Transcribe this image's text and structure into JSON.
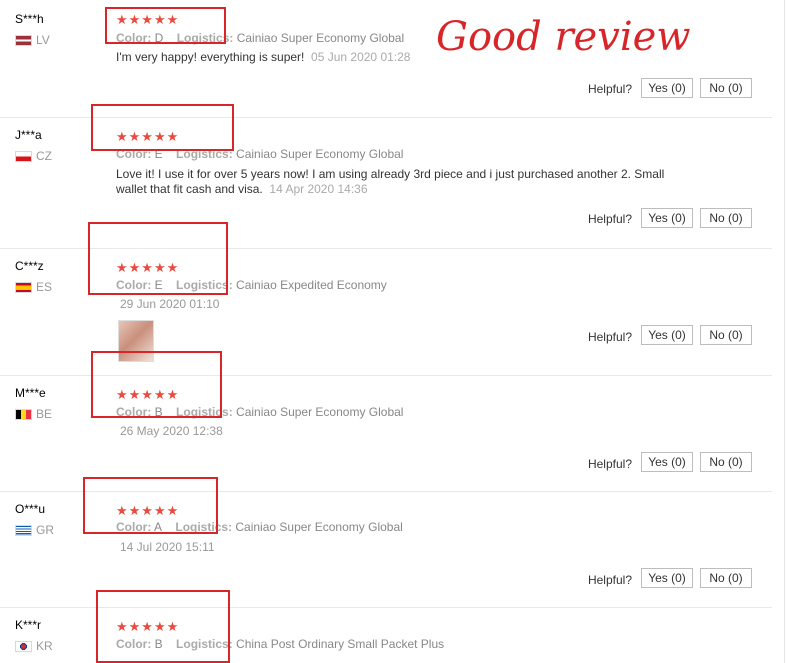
{
  "headline": "Good review",
  "colors": {
    "accent": "#e94b40",
    "annotation": "#d7252a"
  },
  "helpful_label": "Helpful?",
  "reviews": [
    {
      "name": "S***h",
      "country": "LV",
      "stars": "★★★★★",
      "color_label": "Color:",
      "color": "D",
      "logistics_label": "Logistics:",
      "logistics": "Cainiao Super Economy Global",
      "text": "I'm very happy! everything is super!",
      "date": "05 Jun 2020 01:28",
      "yes": "Yes (0)",
      "no": "No (0)"
    },
    {
      "name": "J***a",
      "country": "CZ",
      "stars": "★★★★★",
      "color_label": "Color:",
      "color": "E",
      "logistics_label": "Logistics:",
      "logistics": "Cainiao Super Economy Global",
      "text_line1": "Love it! I use it for over 5 years now! I am using already 3rd piece and i just purchased another 2. Small",
      "text_line2": "wallet that fit cash and visa.",
      "date": "14 Apr 2020 14:36",
      "yes": "Yes (0)",
      "no": "No (0)"
    },
    {
      "name": "C***z",
      "country": "ES",
      "stars": "★★★★★",
      "color_label": "Color:",
      "color": "E",
      "logistics_label": "Logistics:",
      "logistics": "Cainiao Expedited Economy",
      "date": "29 Jun 2020 01:10",
      "yes": "Yes (0)",
      "no": "No (0)"
    },
    {
      "name": "M***e",
      "country": "BE",
      "stars": "★★★★★",
      "color_label": "Color:",
      "color": "B",
      "logistics_label": "Logistics:",
      "logistics": "Cainiao Super Economy Global",
      "date": "26 May 2020 12:38",
      "yes": "Yes (0)",
      "no": "No (0)"
    },
    {
      "name": "O***u",
      "country": "GR",
      "stars": "★★★★★",
      "color_label": "Color:",
      "color": "A",
      "logistics_label": "Logistics:",
      "logistics": "Cainiao Super Economy Global",
      "date": "14 Jul 2020 15:11",
      "yes": "Yes (0)",
      "no": "No (0)"
    },
    {
      "name": "K***r",
      "country": "KR",
      "stars": "★★★★★",
      "color_label": "Color:",
      "color": "B",
      "logistics_label": "Logistics:",
      "logistics": "China Post Ordinary Small Packet Plus"
    }
  ]
}
